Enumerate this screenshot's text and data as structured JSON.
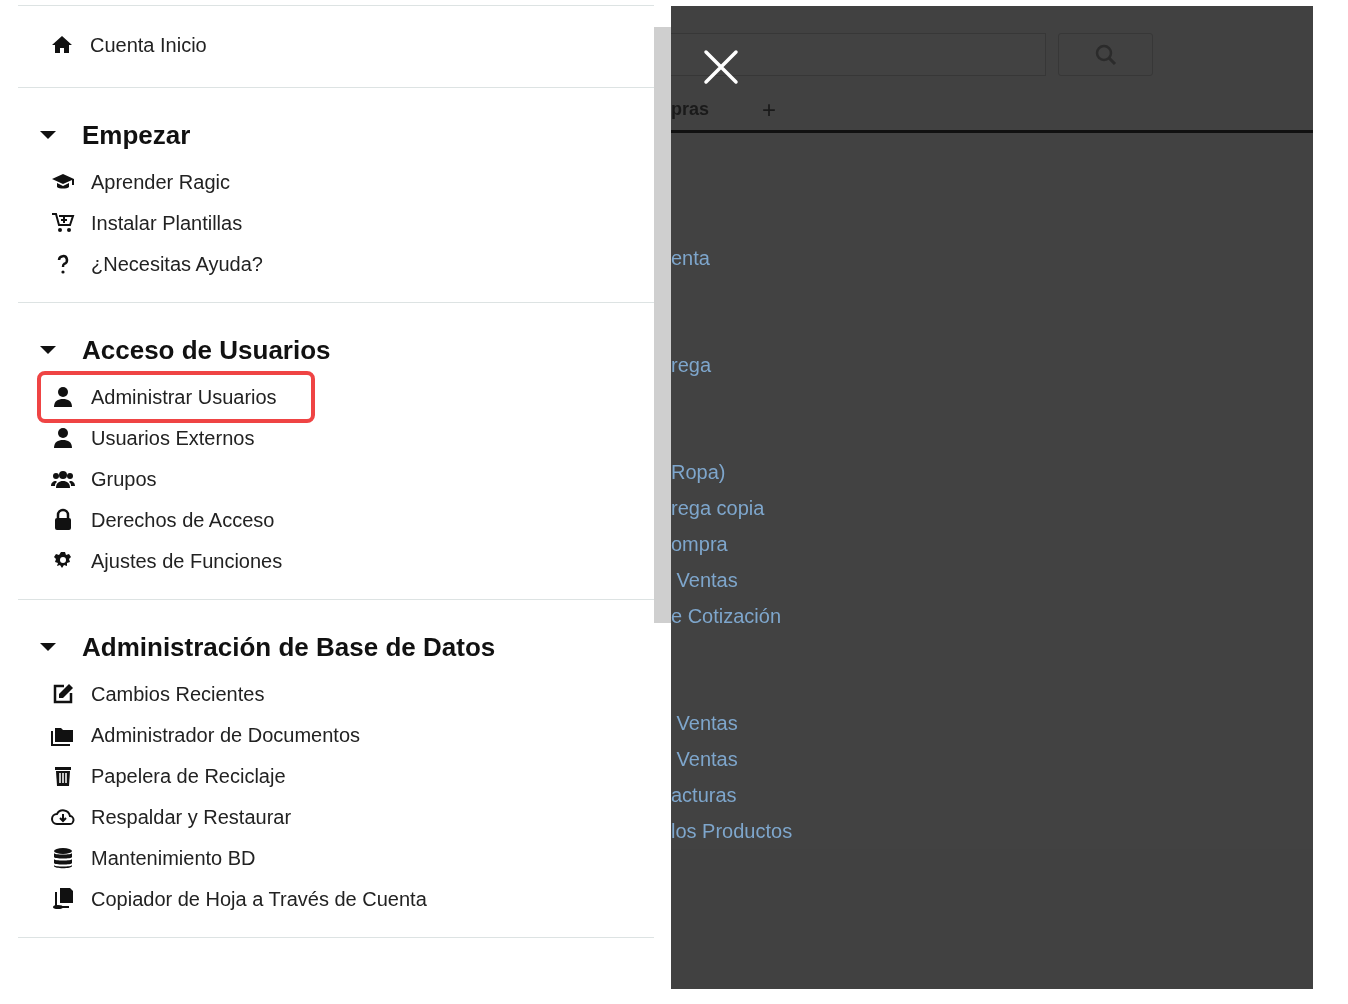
{
  "top_link": {
    "label": "Cuenta Inicio"
  },
  "sections": [
    {
      "title": "Empezar",
      "expanded": true,
      "items": [
        {
          "label": "Aprender Ragic",
          "highlighted": false
        },
        {
          "label": "Instalar Plantillas",
          "highlighted": false
        },
        {
          "label": "¿Necesitas Ayuda?",
          "highlighted": false
        }
      ]
    },
    {
      "title": "Acceso de Usuarios",
      "expanded": true,
      "items": [
        {
          "label": "Administrar Usuarios",
          "highlighted": true
        },
        {
          "label": "Usuarios Externos",
          "highlighted": false
        },
        {
          "label": "Grupos",
          "highlighted": false
        },
        {
          "label": "Derechos de Acceso",
          "highlighted": false
        },
        {
          "label": "Ajustes de Funciones",
          "highlighted": false
        }
      ]
    },
    {
      "title": "Administración de Base de Datos",
      "expanded": true,
      "items": [
        {
          "label": "Cambios Recientes",
          "highlighted": false
        },
        {
          "label": "Administrador de Documentos",
          "highlighted": false
        },
        {
          "label": "Papelera de Reciclaje",
          "highlighted": false
        },
        {
          "label": "Respaldar y Restaurar",
          "highlighted": false
        },
        {
          "label": "Mantenimiento BD",
          "highlighted": false
        },
        {
          "label": "Copiador de Hoja a Través de Cuenta",
          "highlighted": false
        }
      ]
    }
  ],
  "background": {
    "tab": "pras",
    "add_tab": "+",
    "links": [
      {
        "label": "enta"
      },
      {
        "label": "rega"
      },
      {
        "label": "Ropa)"
      },
      {
        "label": "rega copia"
      },
      {
        "label": "ompra"
      },
      {
        "label": " Ventas"
      },
      {
        "label": "e Cotización"
      },
      {
        "label": " Ventas"
      },
      {
        "label": " Ventas"
      },
      {
        "label": "acturas"
      },
      {
        "label": "los Productos"
      }
    ]
  }
}
